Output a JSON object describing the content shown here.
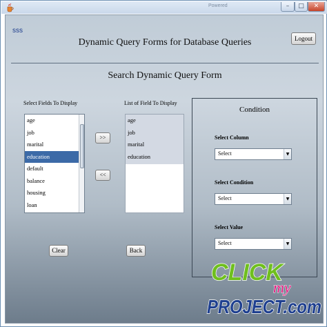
{
  "window": {
    "title": "Powered",
    "minimize_glyph": "–",
    "maximize_glyph": "□",
    "close_glyph": "✕"
  },
  "app": {
    "user_label": "sss",
    "title": "Dynamic Query Forms for Database Queries",
    "logout_label": "Logout"
  },
  "search_form": {
    "title": "Search Dynamic Query Form",
    "fields_label": "Select Fields To Display",
    "fields": [
      "age",
      "job",
      "marital",
      "education",
      "default",
      "balance",
      "housing",
      "loan"
    ],
    "selected_field": "education",
    "display_label": "List of Field To Display",
    "display_fields": [
      "age",
      "job",
      "marital",
      "education"
    ],
    "add_label": ">>",
    "remove_label": "<<",
    "clear_label": "Clear",
    "back_label": "Back"
  },
  "condition": {
    "title": "Condition",
    "column_label": "Select Column",
    "column_value": "Select",
    "condition_label": "Select Condition",
    "condition_value": "Select",
    "value_label": "Select Value",
    "value_value": "Select"
  },
  "watermark": {
    "line1": "CLICK",
    "line2": "my",
    "line3": "PROJECT.com"
  },
  "colors": {
    "selection": "#3c6aa7",
    "logo_green": "#6fbf1e",
    "logo_blue": "#1e3f8f",
    "logo_pink": "#e0127a"
  }
}
